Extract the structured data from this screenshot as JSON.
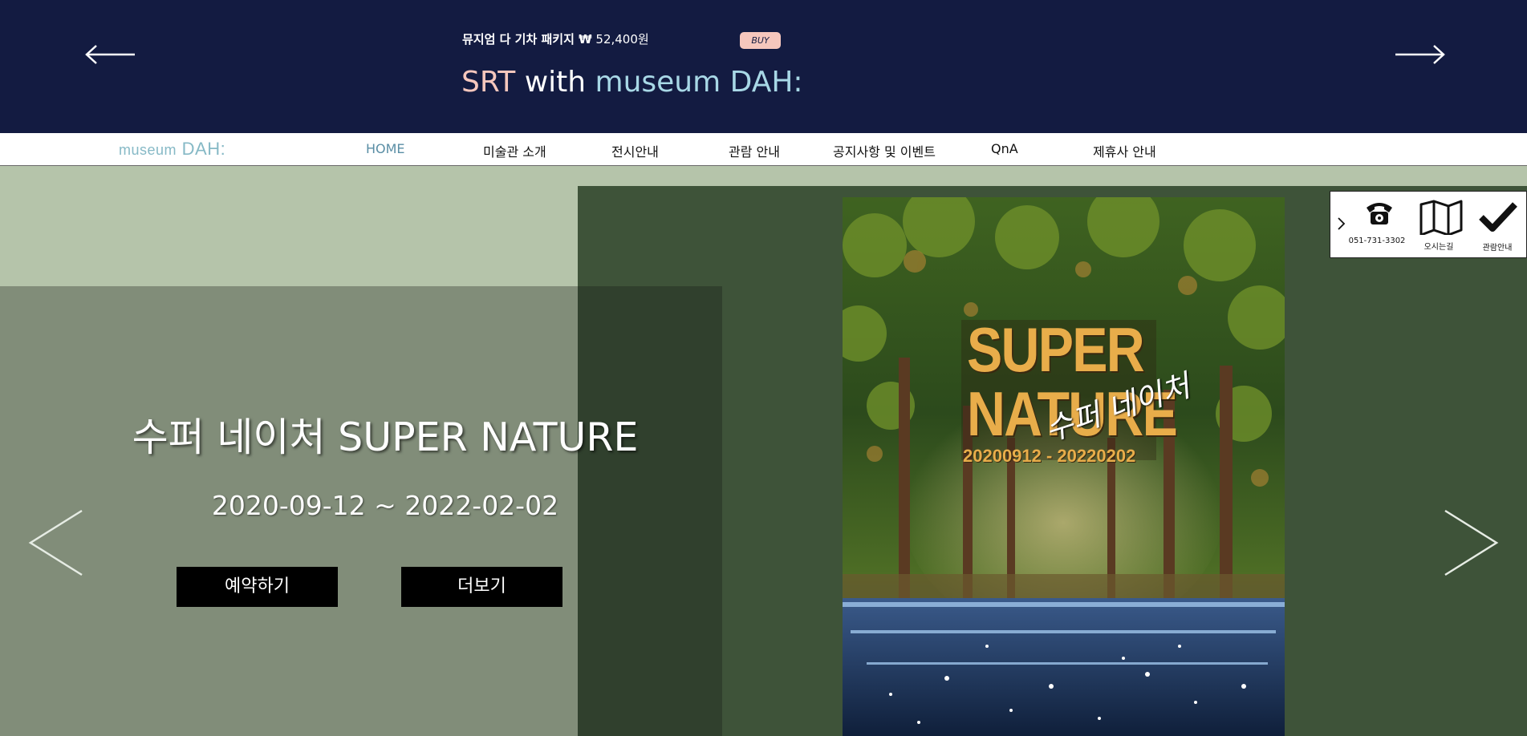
{
  "banner": {
    "promo_name": "뮤지엄 다 기차 패키지 ₩",
    "promo_price": " 52,400원",
    "buy_label": "BUY",
    "title_part1": "SRT",
    "title_part2": " with ",
    "title_part3": "museum DAH:",
    "prev_icon": "arrow-left-icon",
    "next_icon": "arrow-right-icon"
  },
  "nav": {
    "logo_word": "museum",
    "logo_mark": " DAH:",
    "items": [
      {
        "label": "HOME",
        "active": true
      },
      {
        "label": "미술관 소개"
      },
      {
        "label": "전시안내"
      },
      {
        "label": "관람 안내"
      },
      {
        "label": "공지사항 및 이벤트"
      },
      {
        "label": "QnA"
      },
      {
        "label": "제휴사 안내"
      }
    ]
  },
  "hero": {
    "title": "수퍼 네이처 SUPER NATURE",
    "dates": "2020-09-12 ~ 2022-02-02",
    "reserve_label": "예약하기",
    "more_label": "더보기",
    "prev_icon": "chevron-left-icon",
    "next_icon": "chevron-right-icon"
  },
  "poster": {
    "line1": "SUPER",
    "line2": "NATURE",
    "script": "수퍼 네이처",
    "dates": "20200912 - 20220202"
  },
  "quick_menu": {
    "toggle_icon": "chevron-right-icon",
    "phone_label": "051-731-3302",
    "map_label": "오시는길",
    "check_label": "관람안내"
  },
  "colors": {
    "banner_bg": "#131b41",
    "accent_salmon": "#f6c7bd",
    "accent_blue": "#a8d8e6",
    "hero_dark": "#3e5339",
    "hero_light": "#b5c4aa",
    "hero_text_panel": "#818d79"
  }
}
